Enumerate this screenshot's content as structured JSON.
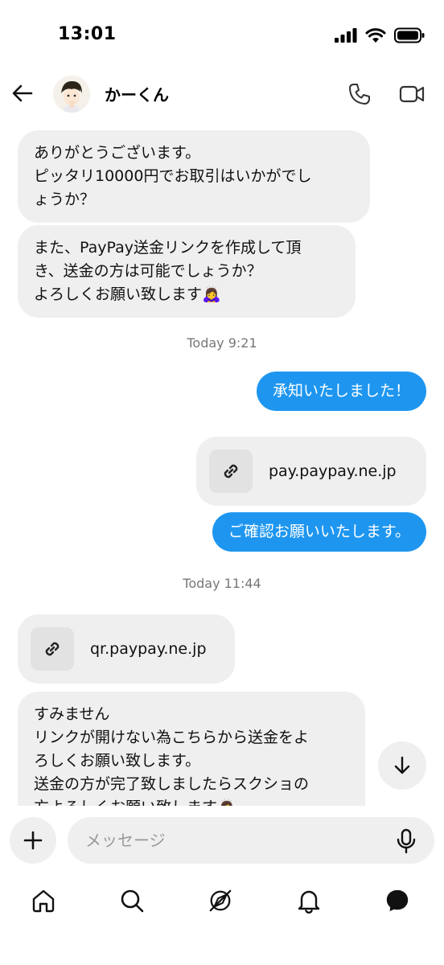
{
  "status_bar": {
    "time": "13:01"
  },
  "header": {
    "contact_name": "かーくん"
  },
  "messages": {
    "m1": "ありがとうございます。\nピッタリ10000円でお取引はいかがでし\nょうか？",
    "m2": "また、PayPay送金リンクを作成して頂\nき、送金の方は可能でしょうか？\nよろしくお願い致します🙇‍♀️",
    "stamp1": "Today 9:21",
    "m3": "承知いたしました！",
    "m4_link": "pay.paypay.ne.jp",
    "m5": "ご確認お願いいたします。",
    "stamp2": "Today 11:44",
    "m6_link": "qr.paypay.ne.jp",
    "m7": "すみません\nリンクが開けない為こちらから送金をよ\nろしくお願い致します。\n送金の方が完了致しましたらスクショの\n方よろしくお願い致します🙇‍♀️"
  },
  "composer": {
    "placeholder": "メッセージ"
  },
  "colors": {
    "outgoing": "#1e96f0",
    "incoming": "#efefef"
  },
  "icons": [
    "back-arrow-icon",
    "phone-icon",
    "video-icon",
    "link-icon",
    "arrow-down-icon",
    "plus-icon",
    "mic-icon",
    "home-icon",
    "search-icon",
    "explore-icon",
    "bell-icon",
    "messenger-icon"
  ]
}
